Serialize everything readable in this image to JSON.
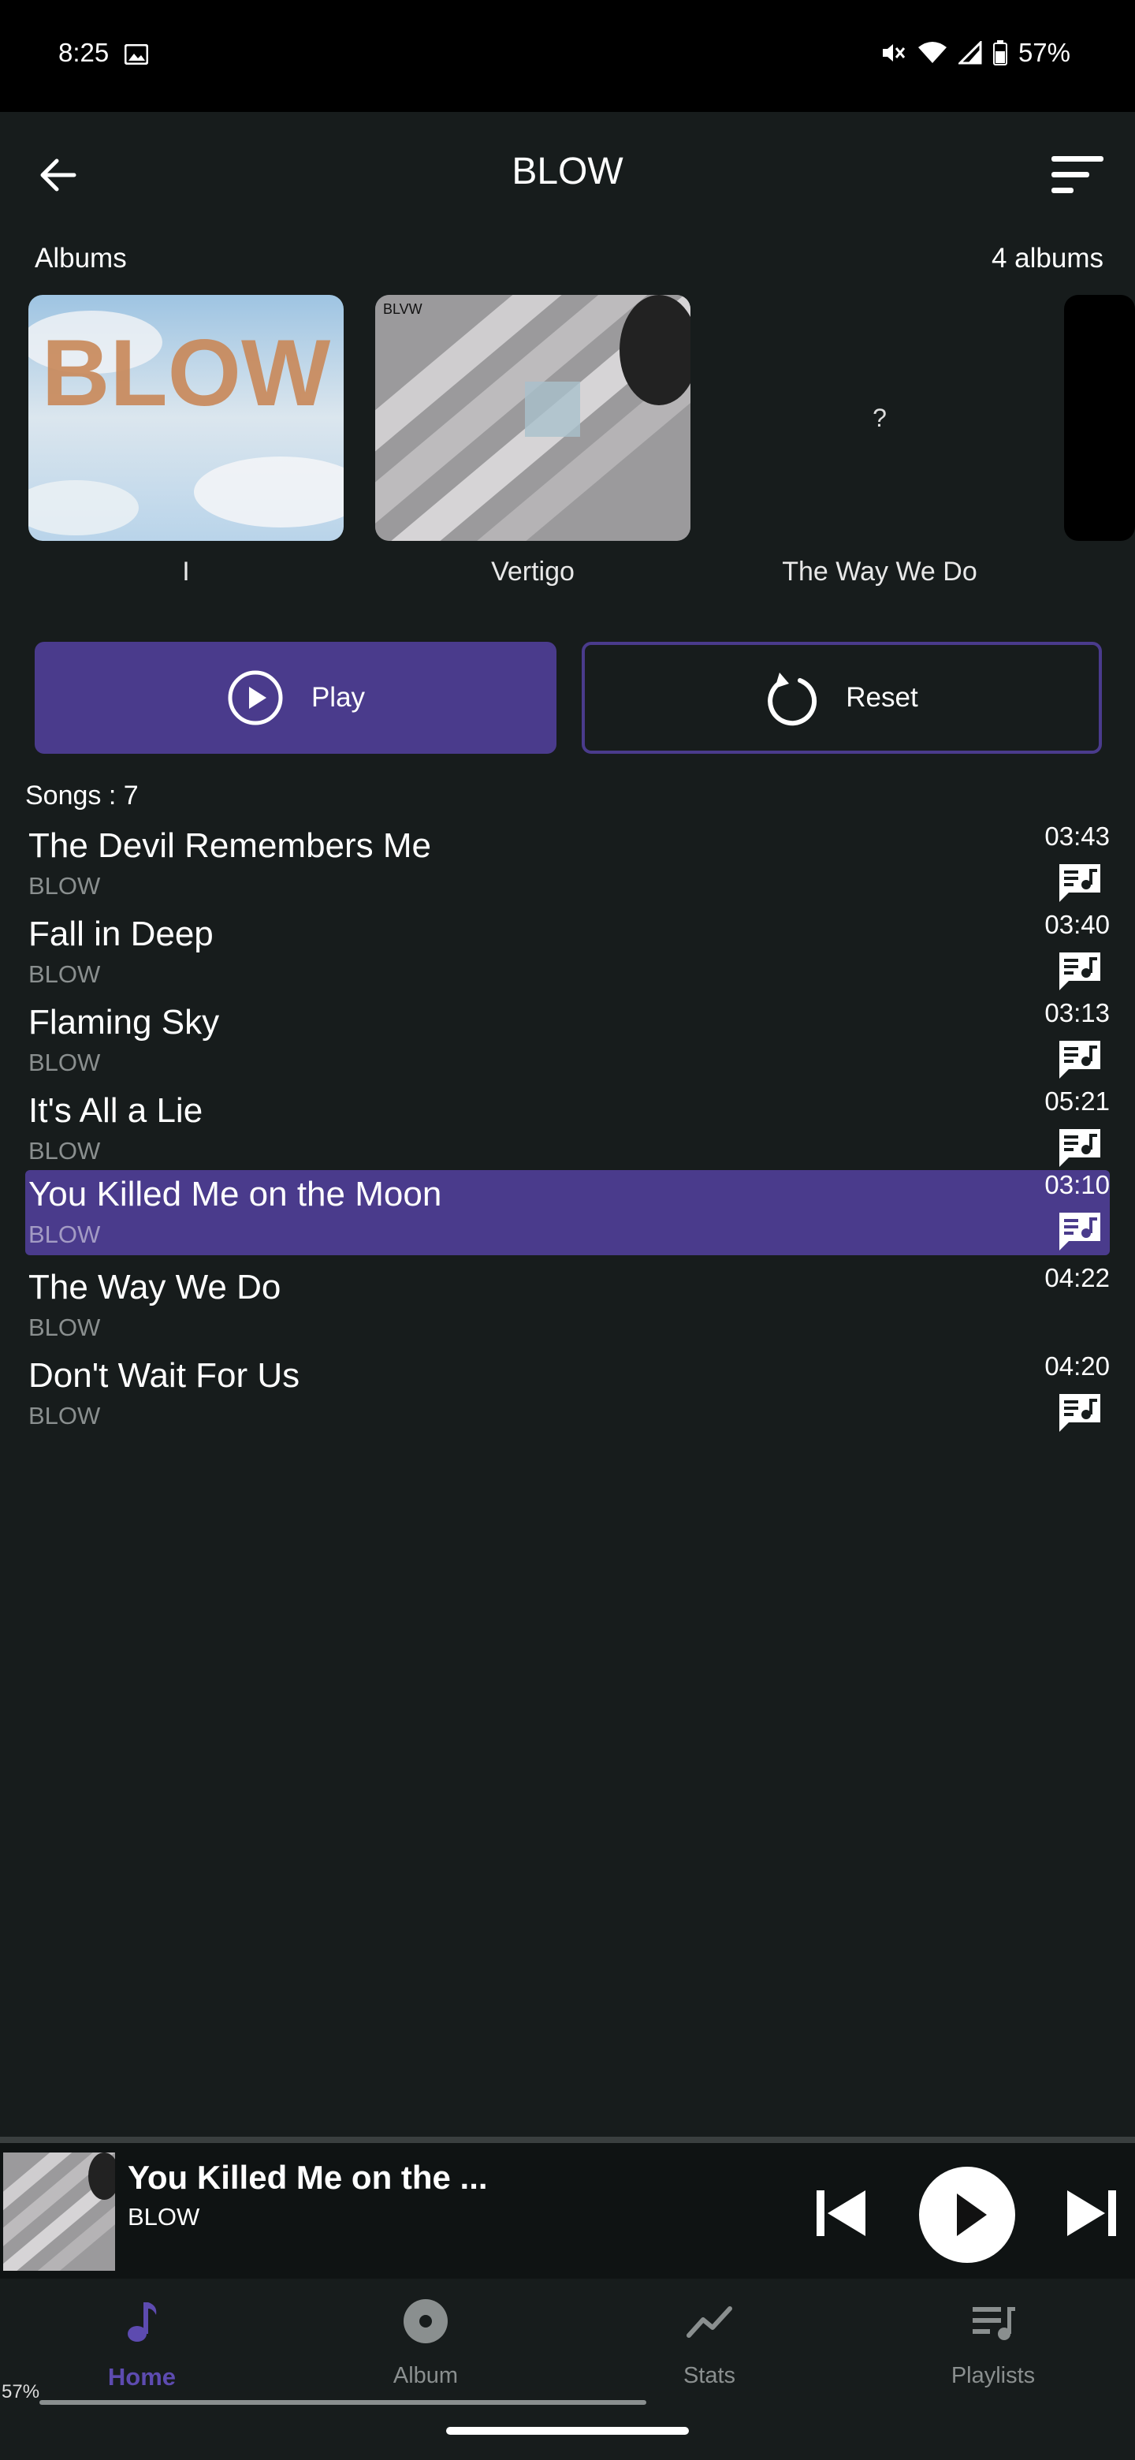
{
  "status_bar": {
    "time": "8:25",
    "battery": "57%"
  },
  "header": {
    "title": "BLOW"
  },
  "albums": {
    "label": "Albums",
    "count": "4 albums",
    "items": [
      {
        "title": "I",
        "art_text": "BLOW"
      },
      {
        "title": "Vertigo",
        "art_text": "BLVW"
      },
      {
        "title": "The Way We Do",
        "art_text": "?"
      },
      {
        "title": ""
      }
    ]
  },
  "actions": {
    "play_label": "Play",
    "reset_label": "Reset"
  },
  "songs": {
    "count_label": "Songs : 7",
    "items": [
      {
        "title": "The Devil Remembers Me",
        "artist": "BLOW",
        "duration": "03:43",
        "has_lyrics": true
      },
      {
        "title": "Fall in Deep",
        "artist": "BLOW",
        "duration": "03:40",
        "has_lyrics": true
      },
      {
        "title": "Flaming Sky",
        "artist": "BLOW",
        "duration": "03:13",
        "has_lyrics": true
      },
      {
        "title": "It's All a Lie",
        "artist": "BLOW",
        "duration": "05:21",
        "has_lyrics": true
      },
      {
        "title": "You Killed Me on the Moon",
        "artist": "BLOW",
        "duration": "03:10",
        "has_lyrics": true,
        "playing": true
      },
      {
        "title": "The Way We Do",
        "artist": "BLOW",
        "duration": "04:22",
        "has_lyrics": false
      },
      {
        "title": "Don't Wait For Us",
        "artist": "BLOW",
        "duration": "04:20",
        "has_lyrics": true
      }
    ]
  },
  "mini_player": {
    "title": "You Killed Me on the ...",
    "artist": "BLOW"
  },
  "bottom_nav": {
    "items": [
      {
        "label": "Home",
        "active": true
      },
      {
        "label": "Album"
      },
      {
        "label": "Stats"
      },
      {
        "label": "Playlists"
      }
    ],
    "percent": "57%"
  },
  "colors": {
    "accent": "#4a3b8c",
    "nav_active": "#5d4bb0",
    "background": "#171c1c"
  }
}
